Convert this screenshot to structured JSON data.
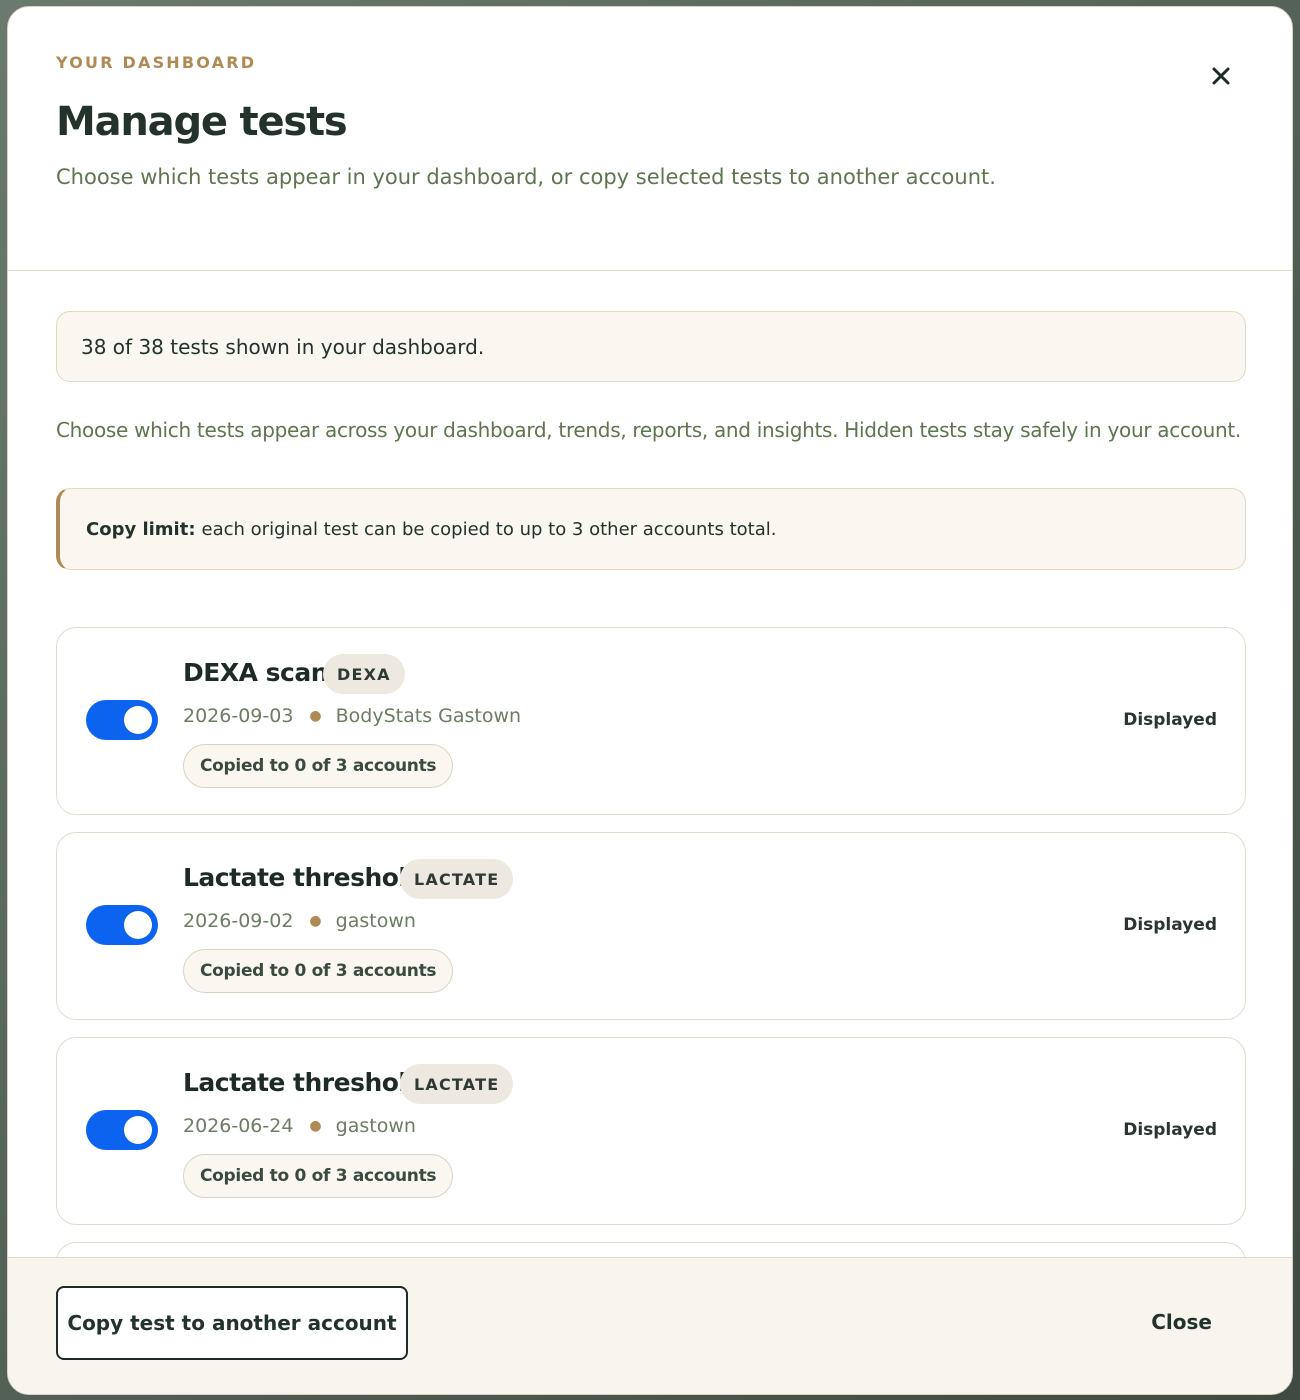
{
  "header": {
    "eyebrow": "YOUR DASHBOARD",
    "title": "Manage tests",
    "subtitle": "Choose which tests appear in your dashboard, or copy selected tests to another account."
  },
  "summary": {
    "count_text": "38 of 38 tests shown in your dashboard.",
    "description": "Choose which tests appear across your dashboard, trends, reports, and insights. Hidden tests stay safely in your account."
  },
  "copy_limit": {
    "label": "Copy limit:",
    "text": "each original test can be copied to up to 3 other accounts total."
  },
  "tests": [
    {
      "name": "DEXA scan",
      "tag": "DEXA",
      "date": "2026-09-03",
      "location": "BodyStats Gastown",
      "copied": "Copied to 0 of 3 accounts",
      "status": "Displayed",
      "enabled": true
    },
    {
      "name": "Lactate threshold",
      "tag": "LACTATE",
      "date": "2026-09-02",
      "location": "gastown",
      "copied": "Copied to 0 of 3 accounts",
      "status": "Displayed",
      "enabled": true
    },
    {
      "name": "Lactate threshold",
      "tag": "LACTATE",
      "date": "2026-06-24",
      "location": "gastown",
      "copied": "Copied to 0 of 3 accounts",
      "status": "Displayed",
      "enabled": true
    }
  ],
  "footer": {
    "copy_button": "Copy test to another account",
    "close_button": "Close"
  },
  "colors": {
    "toggle_on": "#0b63f0",
    "accent": "#b08a55",
    "heading": "#23332b"
  },
  "icons": {
    "close": "close-icon"
  }
}
